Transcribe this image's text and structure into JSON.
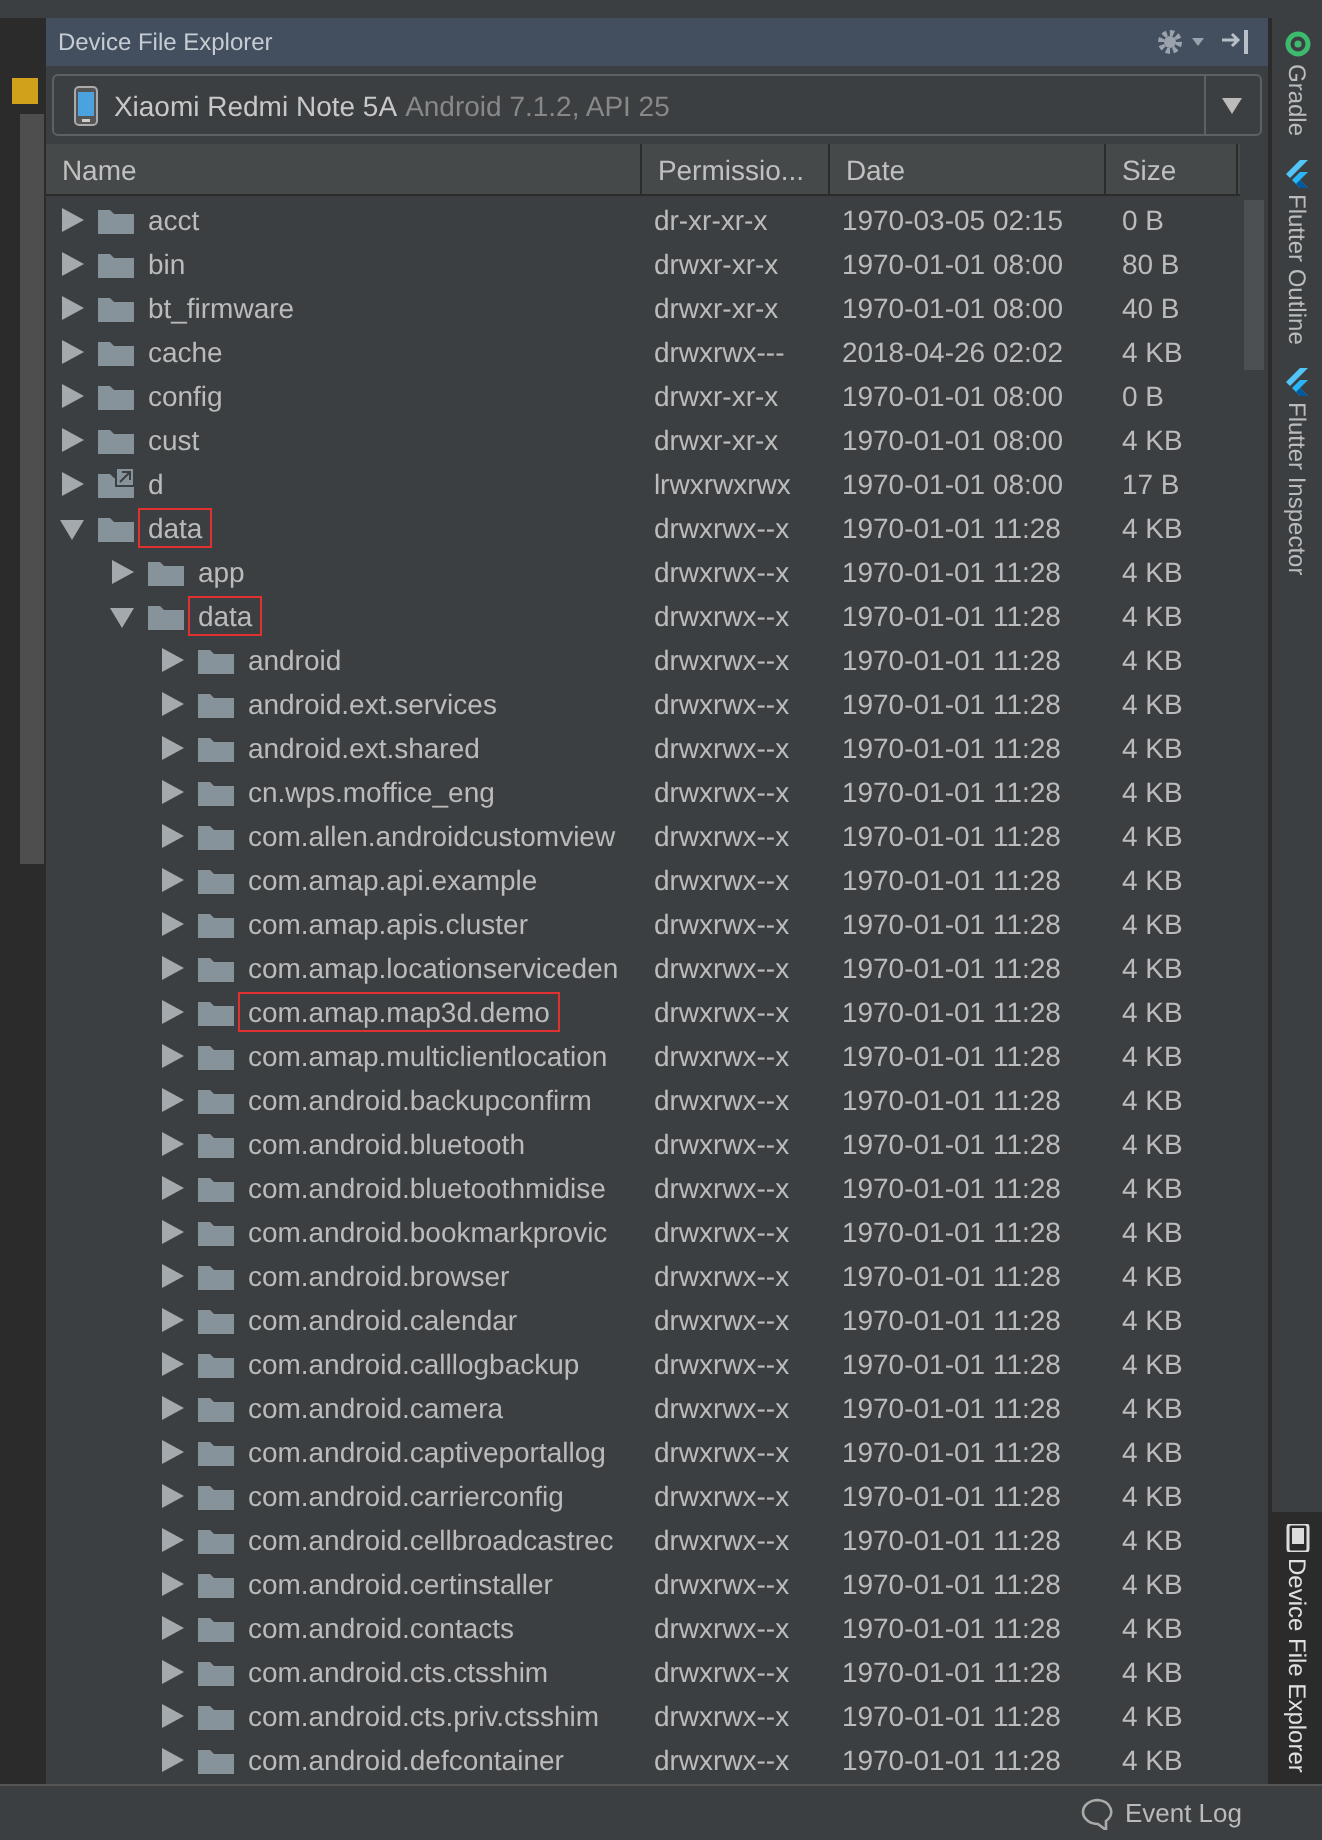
{
  "panel": {
    "title": "Device File Explorer"
  },
  "device": {
    "name": "Xiaomi Redmi Note 5A",
    "detail": "Android 7.1.2, API 25"
  },
  "table": {
    "columns": [
      "Name",
      "Permissio...",
      "Date",
      "Size"
    ],
    "rows": [
      {
        "name": "acct",
        "permissions": "dr-xr-xr-x",
        "date": "1970-03-05 02:15",
        "size": "0 B",
        "expanded": false,
        "symlink": false,
        "highlighted": false
      },
      {
        "name": "bin",
        "permissions": "drwxr-xr-x",
        "date": "1970-01-01 08:00",
        "size": "80 B",
        "expanded": false,
        "symlink": false,
        "highlighted": false
      },
      {
        "name": "bt_firmware",
        "permissions": "drwxr-xr-x",
        "date": "1970-01-01 08:00",
        "size": "40 B",
        "expanded": false,
        "symlink": false,
        "highlighted": false
      },
      {
        "name": "cache",
        "permissions": "drwxrwx---",
        "date": "2018-04-26 02:02",
        "size": "4 KB",
        "expanded": false,
        "symlink": false,
        "highlighted": false
      },
      {
        "name": "config",
        "permissions": "drwxr-xr-x",
        "date": "1970-01-01 08:00",
        "size": "0 B",
        "expanded": false,
        "symlink": false,
        "highlighted": false
      },
      {
        "name": "cust",
        "permissions": "drwxr-xr-x",
        "date": "1970-01-01 08:00",
        "size": "4 KB",
        "expanded": false,
        "symlink": false,
        "highlighted": false
      },
      {
        "name": "d",
        "permissions": "lrwxrwxrwx",
        "date": "1970-01-01 08:00",
        "size": "17 B",
        "expanded": false,
        "symlink": true,
        "highlighted": false
      },
      {
        "name": "data",
        "permissions": "drwxrwx--x",
        "date": "1970-01-01 11:28",
        "size": "4 KB",
        "expanded": true,
        "symlink": false,
        "highlighted": true,
        "children": [
          {
            "name": "app",
            "permissions": "drwxrwx--x",
            "date": "1970-01-01 11:28",
            "size": "4 KB",
            "expanded": false,
            "symlink": false,
            "highlighted": false
          },
          {
            "name": "data",
            "permissions": "drwxrwx--x",
            "date": "1970-01-01 11:28",
            "size": "4 KB",
            "expanded": true,
            "symlink": false,
            "highlighted": true,
            "children": [
              {
                "name": "android",
                "permissions": "drwxrwx--x",
                "date": "1970-01-01 11:28",
                "size": "4 KB",
                "expanded": false,
                "symlink": false,
                "highlighted": false
              },
              {
                "name": "android.ext.services",
                "permissions": "drwxrwx--x",
                "date": "1970-01-01 11:28",
                "size": "4 KB",
                "expanded": false,
                "symlink": false,
                "highlighted": false
              },
              {
                "name": "android.ext.shared",
                "permissions": "drwxrwx--x",
                "date": "1970-01-01 11:28",
                "size": "4 KB",
                "expanded": false,
                "symlink": false,
                "highlighted": false
              },
              {
                "name": "cn.wps.moffice_eng",
                "permissions": "drwxrwx--x",
                "date": "1970-01-01 11:28",
                "size": "4 KB",
                "expanded": false,
                "symlink": false,
                "highlighted": false
              },
              {
                "name": "com.allen.androidcustomview",
                "permissions": "drwxrwx--x",
                "date": "1970-01-01 11:28",
                "size": "4 KB",
                "expanded": false,
                "symlink": false,
                "highlighted": false
              },
              {
                "name": "com.amap.api.example",
                "permissions": "drwxrwx--x",
                "date": "1970-01-01 11:28",
                "size": "4 KB",
                "expanded": false,
                "symlink": false,
                "highlighted": false
              },
              {
                "name": "com.amap.apis.cluster",
                "permissions": "drwxrwx--x",
                "date": "1970-01-01 11:28",
                "size": "4 KB",
                "expanded": false,
                "symlink": false,
                "highlighted": false
              },
              {
                "name": "com.amap.locationserviceden",
                "permissions": "drwxrwx--x",
                "date": "1970-01-01 11:28",
                "size": "4 KB",
                "expanded": false,
                "symlink": false,
                "highlighted": false
              },
              {
                "name": "com.amap.map3d.demo",
                "permissions": "drwxrwx--x",
                "date": "1970-01-01 11:28",
                "size": "4 KB",
                "expanded": false,
                "symlink": false,
                "highlighted": true
              },
              {
                "name": "com.amap.multiclientlocation",
                "permissions": "drwxrwx--x",
                "date": "1970-01-01 11:28",
                "size": "4 KB",
                "expanded": false,
                "symlink": false,
                "highlighted": false
              },
              {
                "name": "com.android.backupconfirm",
                "permissions": "drwxrwx--x",
                "date": "1970-01-01 11:28",
                "size": "4 KB",
                "expanded": false,
                "symlink": false,
                "highlighted": false
              },
              {
                "name": "com.android.bluetooth",
                "permissions": "drwxrwx--x",
                "date": "1970-01-01 11:28",
                "size": "4 KB",
                "expanded": false,
                "symlink": false,
                "highlighted": false
              },
              {
                "name": "com.android.bluetoothmidise",
                "permissions": "drwxrwx--x",
                "date": "1970-01-01 11:28",
                "size": "4 KB",
                "expanded": false,
                "symlink": false,
                "highlighted": false
              },
              {
                "name": "com.android.bookmarkprovic",
                "permissions": "drwxrwx--x",
                "date": "1970-01-01 11:28",
                "size": "4 KB",
                "expanded": false,
                "symlink": false,
                "highlighted": false
              },
              {
                "name": "com.android.browser",
                "permissions": "drwxrwx--x",
                "date": "1970-01-01 11:28",
                "size": "4 KB",
                "expanded": false,
                "symlink": false,
                "highlighted": false
              },
              {
                "name": "com.android.calendar",
                "permissions": "drwxrwx--x",
                "date": "1970-01-01 11:28",
                "size": "4 KB",
                "expanded": false,
                "symlink": false,
                "highlighted": false
              },
              {
                "name": "com.android.calllogbackup",
                "permissions": "drwxrwx--x",
                "date": "1970-01-01 11:28",
                "size": "4 KB",
                "expanded": false,
                "symlink": false,
                "highlighted": false
              },
              {
                "name": "com.android.camera",
                "permissions": "drwxrwx--x",
                "date": "1970-01-01 11:28",
                "size": "4 KB",
                "expanded": false,
                "symlink": false,
                "highlighted": false
              },
              {
                "name": "com.android.captiveportallog",
                "permissions": "drwxrwx--x",
                "date": "1970-01-01 11:28",
                "size": "4 KB",
                "expanded": false,
                "symlink": false,
                "highlighted": false
              },
              {
                "name": "com.android.carrierconfig",
                "permissions": "drwxrwx--x",
                "date": "1970-01-01 11:28",
                "size": "4 KB",
                "expanded": false,
                "symlink": false,
                "highlighted": false
              },
              {
                "name": "com.android.cellbroadcastrec",
                "permissions": "drwxrwx--x",
                "date": "1970-01-01 11:28",
                "size": "4 KB",
                "expanded": false,
                "symlink": false,
                "highlighted": false
              },
              {
                "name": "com.android.certinstaller",
                "permissions": "drwxrwx--x",
                "date": "1970-01-01 11:28",
                "size": "4 KB",
                "expanded": false,
                "symlink": false,
                "highlighted": false
              },
              {
                "name": "com.android.contacts",
                "permissions": "drwxrwx--x",
                "date": "1970-01-01 11:28",
                "size": "4 KB",
                "expanded": false,
                "symlink": false,
                "highlighted": false
              },
              {
                "name": "com.android.cts.ctsshim",
                "permissions": "drwxrwx--x",
                "date": "1970-01-01 11:28",
                "size": "4 KB",
                "expanded": false,
                "symlink": false,
                "highlighted": false
              },
              {
                "name": "com.android.cts.priv.ctsshim",
                "permissions": "drwxrwx--x",
                "date": "1970-01-01 11:28",
                "size": "4 KB",
                "expanded": false,
                "symlink": false,
                "highlighted": false
              },
              {
                "name": "com.android.defcontainer",
                "permissions": "drwxrwx--x",
                "date": "1970-01-01 11:28",
                "size": "4 KB",
                "expanded": false,
                "symlink": false,
                "highlighted": false
              }
            ]
          }
        ]
      }
    ]
  },
  "right_toolbar": [
    {
      "label": "Gradle",
      "kind": "gradle",
      "selected": false
    },
    {
      "label": "Flutter Outline",
      "kind": "flutter",
      "selected": false
    },
    {
      "label": "Flutter Inspector",
      "kind": "flutter",
      "selected": false
    },
    {
      "label": "Device File Explorer",
      "kind": "device",
      "selected": true
    }
  ],
  "status_bar": {
    "event_log": "Event Log"
  }
}
